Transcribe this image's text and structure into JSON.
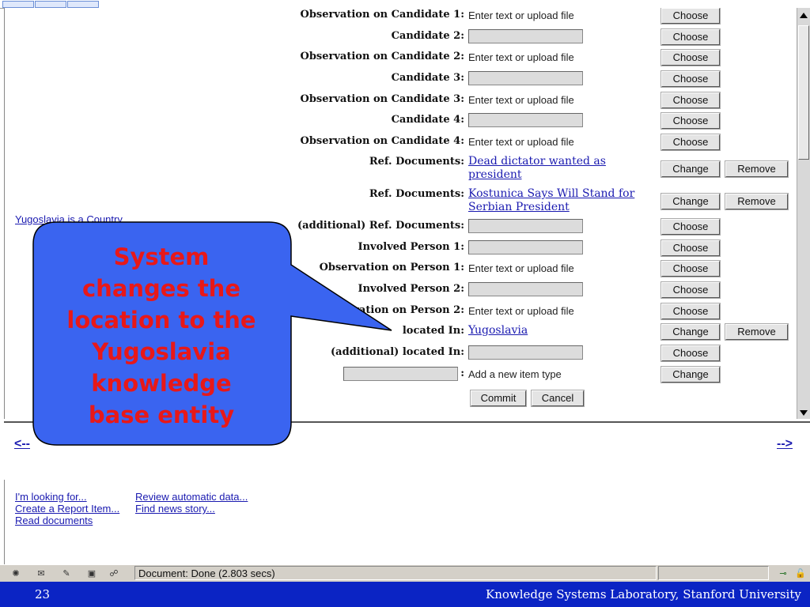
{
  "left_pane": {
    "link_text": "Yugoslavia is a Country"
  },
  "form": {
    "rows": [
      {
        "label": "Observation on Candidate 1:",
        "kind": "text",
        "value": "Enter text or upload file",
        "button": "Choose"
      },
      {
        "label": "Candidate 2:",
        "kind": "field",
        "button": "Choose"
      },
      {
        "label": "Observation on Candidate 2:",
        "kind": "text",
        "value": "Enter text or upload file",
        "button": "Choose"
      },
      {
        "label": "Candidate 3:",
        "kind": "field",
        "button": "Choose"
      },
      {
        "label": "Observation on Candidate 3:",
        "kind": "text",
        "value": "Enter text or upload file",
        "button": "Choose"
      },
      {
        "label": "Candidate 4:",
        "kind": "field",
        "button": "Choose"
      },
      {
        "label": "Observation on Candidate 4:",
        "kind": "text",
        "value": "Enter text or upload file",
        "button": "Choose"
      },
      {
        "label": "Ref. Documents:",
        "kind": "link",
        "value": "Dead dictator wanted as president",
        "button": "Change",
        "button2": "Remove"
      },
      {
        "label": "Ref. Documents:",
        "kind": "link",
        "value": "Kostunica Says Will Stand for Serbian President",
        "button": "Change",
        "button2": "Remove"
      },
      {
        "label": "(additional) Ref. Documents:",
        "kind": "field",
        "button": "Choose"
      },
      {
        "label": "Involved Person 1:",
        "kind": "field",
        "button": "Choose"
      },
      {
        "label": "Observation on Person 1:",
        "kind": "text",
        "value": "Enter text or upload file",
        "button": "Choose"
      },
      {
        "label": "Involved Person 2:",
        "kind": "field",
        "button": "Choose"
      },
      {
        "label": "Observation on Person 2:",
        "kind": "text",
        "value": "Enter text or upload file",
        "button": "Choose"
      },
      {
        "label": "located In:",
        "kind": "link",
        "value": "Yugoslavia",
        "button": "Change",
        "button2": "Remove"
      },
      {
        "label": "(additional) located In:",
        "kind": "field",
        "button": "Choose"
      },
      {
        "label": ":",
        "kind": "newtype",
        "value": "Add a new item type",
        "button": "Change"
      }
    ],
    "commit_label": "Commit",
    "cancel_label": "Cancel"
  },
  "nav": {
    "prev": "<--",
    "next": "-->"
  },
  "bottom_links": {
    "col1": [
      "I'm looking for...",
      "Create a Report Item...",
      "Read documents"
    ],
    "col2": [
      "Review automatic data...",
      "Find news story..."
    ]
  },
  "status": {
    "text": "Document: Done (2.803 secs)"
  },
  "footer": {
    "slide_number": "23",
    "org": "Knowledge Systems Laboratory, Stanford University"
  },
  "callout": {
    "lines": [
      "System",
      "changes the",
      "location to the",
      "Yugoslavia",
      "knowledge",
      "base entity"
    ]
  },
  "colors": {
    "link": "#1a1ab0",
    "footer_bg": "#0b24c4",
    "callout_bg": "#3a64f0",
    "callout_text": "#e81818"
  }
}
